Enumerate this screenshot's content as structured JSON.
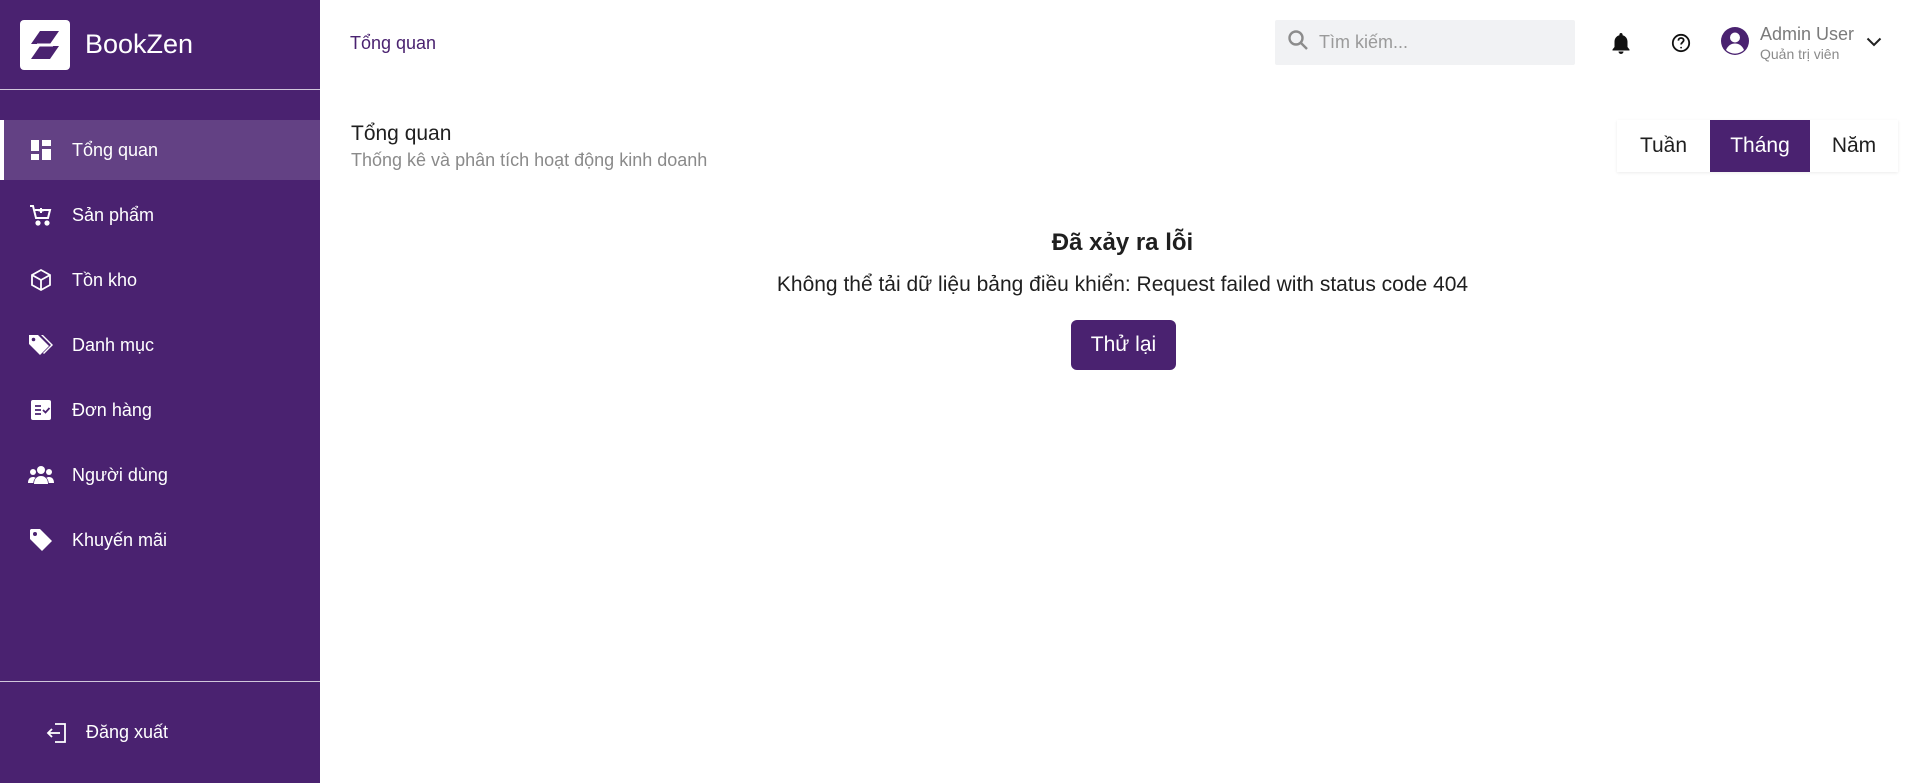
{
  "app": {
    "name": "BookZen"
  },
  "sidebar": {
    "items": [
      {
        "label": "Tổng quan",
        "icon": "dashboard-icon",
        "active": true
      },
      {
        "label": "Sản phẩm",
        "icon": "cart-icon"
      },
      {
        "label": "Tồn kho",
        "icon": "box-icon"
      },
      {
        "label": "Danh mục",
        "icon": "tags-icon"
      },
      {
        "label": "Đơn hàng",
        "icon": "order-list-icon"
      },
      {
        "label": "Người dùng",
        "icon": "users-icon"
      },
      {
        "label": "Khuyến mãi",
        "icon": "tag-icon"
      }
    ],
    "logout_label": "Đăng xuất"
  },
  "header": {
    "breadcrumb": "Tổng quan",
    "search_placeholder": "Tìm kiếm...",
    "user_name": "Admin User",
    "user_role": "Quản trị viên"
  },
  "page": {
    "title": "Tổng quan",
    "subtitle": "Thống kê và phân tích hoạt động kinh doanh",
    "periods": [
      {
        "label": "Tuần"
      },
      {
        "label": "Tháng",
        "active": true
      },
      {
        "label": "Năm"
      }
    ]
  },
  "error": {
    "title": "Đã xảy ra lỗi",
    "message": "Không thể tải dữ liệu bảng điều khiển: Request failed with status code 404",
    "retry_label": "Thử lại"
  },
  "colors": {
    "brand": "#4a2270"
  }
}
